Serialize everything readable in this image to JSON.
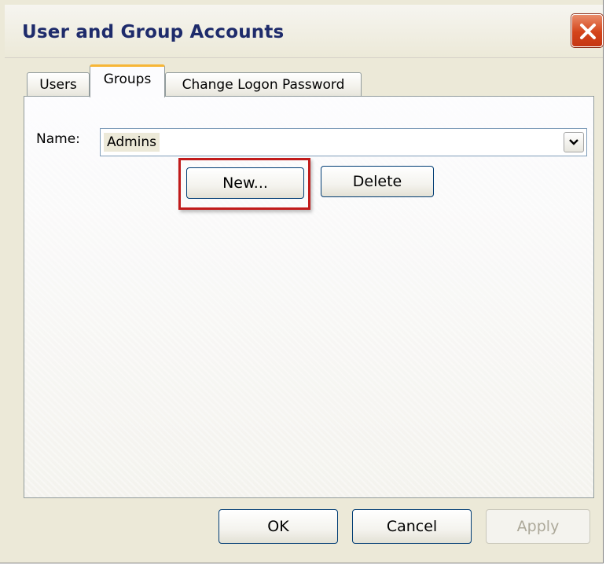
{
  "window": {
    "title": "User and Group Accounts",
    "close_icon": "close-icon"
  },
  "tabs": [
    {
      "label": "Users",
      "active": false
    },
    {
      "label": "Groups",
      "active": true
    },
    {
      "label": "Change Logon Password",
      "active": false
    }
  ],
  "groups_tab": {
    "name_label": "Name:",
    "name_value": "Admins",
    "dropdown_icon": "chevron-down-icon",
    "new_label": "New...",
    "delete_label": "Delete"
  },
  "footer": {
    "ok_label": "OK",
    "cancel_label": "Cancel",
    "apply_label": "Apply",
    "apply_enabled": false
  },
  "annotation": {
    "highlight_color": "#c11b1b"
  }
}
